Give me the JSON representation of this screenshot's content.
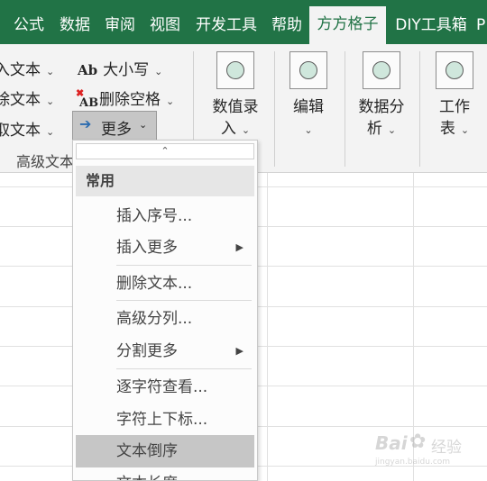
{
  "tabs": [
    "公式",
    "数据",
    "审阅",
    "视图",
    "开发工具",
    "帮助",
    "方方格子",
    "DIY工具箱",
    "P"
  ],
  "active_tab": "方方格子",
  "ribbon": {
    "left_items": [
      "入文本",
      "除文本",
      "取文本"
    ],
    "case_label": "大小写",
    "delete_space_label": "删除空格",
    "more_label": "更多",
    "group_label": "高级文本",
    "groups": [
      {
        "line1": "数值录",
        "line2": "入"
      },
      {
        "line1": "编辑",
        "line2": ""
      },
      {
        "line1": "数据分",
        "line2": "析"
      },
      {
        "line1": "工作",
        "line2": "表"
      }
    ]
  },
  "menu": {
    "header": "常用",
    "items": [
      "插入序号...",
      "插入更多",
      "删除文本...",
      "高级分列...",
      "分割更多",
      "逐字符查看...",
      "字符上下标...",
      "文本倒序",
      "文本长度"
    ],
    "highlighted": "文本倒序"
  },
  "watermark": {
    "brand": "Bai",
    "brand2": "经验",
    "url": "jingyan.baidu.com"
  },
  "colors": {
    "excel_green": "#217346",
    "ribbon_bg": "#f3f3f3",
    "highlight": "#c6c6c6"
  }
}
